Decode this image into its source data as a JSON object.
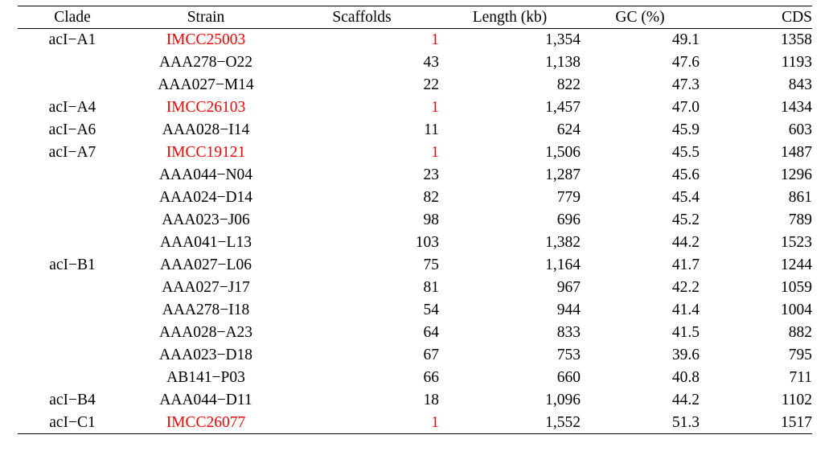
{
  "table": {
    "columns": [
      {
        "key": "clade",
        "label": "Clade",
        "align": "center"
      },
      {
        "key": "strain",
        "label": "Strain",
        "align": "center"
      },
      {
        "key": "scaffolds",
        "label": "Scaffolds",
        "align": "right"
      },
      {
        "key": "length",
        "label": "Length (kb)",
        "align": "right"
      },
      {
        "key": "gc",
        "label": "GC (%)",
        "align": "right"
      },
      {
        "key": "cds",
        "label": "CDS",
        "align": "right"
      }
    ],
    "highlight_color": "#ff0000",
    "text_color": "#000000",
    "rule_color": "#000000",
    "rows": [
      {
        "clade": "acI−A1",
        "strain": "IMCC25003",
        "scaffolds": "1",
        "length": "1,354",
        "gc": "49.1",
        "cds": "1358",
        "highlight": true
      },
      {
        "clade": "",
        "strain": "AAA278−O22",
        "scaffolds": "43",
        "length": "1,138",
        "gc": "47.6",
        "cds": "1193",
        "highlight": false
      },
      {
        "clade": "",
        "strain": "AAA027−M14",
        "scaffolds": "22",
        "length": "822",
        "gc": "47.3",
        "cds": "843",
        "highlight": false
      },
      {
        "clade": "acI−A4",
        "strain": "IMCC26103",
        "scaffolds": "1",
        "length": "1,457",
        "gc": "47.0",
        "cds": "1434",
        "highlight": true
      },
      {
        "clade": "acI−A6",
        "strain": "AAA028−I14",
        "scaffolds": "11",
        "length": "624",
        "gc": "45.9",
        "cds": "603",
        "highlight": false
      },
      {
        "clade": "acI−A7",
        "strain": "IMCC19121",
        "scaffolds": "1",
        "length": "1,506",
        "gc": "45.5",
        "cds": "1487",
        "highlight": true
      },
      {
        "clade": "",
        "strain": "AAA044−N04",
        "scaffolds": "23",
        "length": "1,287",
        "gc": "45.6",
        "cds": "1296",
        "highlight": false
      },
      {
        "clade": "",
        "strain": "AAA024−D14",
        "scaffolds": "82",
        "length": "779",
        "gc": "45.4",
        "cds": "861",
        "highlight": false
      },
      {
        "clade": "",
        "strain": "AAA023−J06",
        "scaffolds": "98",
        "length": "696",
        "gc": "45.2",
        "cds": "789",
        "highlight": false
      },
      {
        "clade": "",
        "strain": "AAA041−L13",
        "scaffolds": "103",
        "length": "1,382",
        "gc": "44.2",
        "cds": "1523",
        "highlight": false
      },
      {
        "clade": "acI−B1",
        "strain": "AAA027−L06",
        "scaffolds": "75",
        "length": "1,164",
        "gc": "41.7",
        "cds": "1244",
        "highlight": false
      },
      {
        "clade": "",
        "strain": "AAA027−J17",
        "scaffolds": "81",
        "length": "967",
        "gc": "42.2",
        "cds": "1059",
        "highlight": false
      },
      {
        "clade": "",
        "strain": "AAA278−I18",
        "scaffolds": "54",
        "length": "944",
        "gc": "41.4",
        "cds": "1004",
        "highlight": false
      },
      {
        "clade": "",
        "strain": "AAA028−A23",
        "scaffolds": "64",
        "length": "833",
        "gc": "41.5",
        "cds": "882",
        "highlight": false
      },
      {
        "clade": "",
        "strain": "AAA023−D18",
        "scaffolds": "67",
        "length": "753",
        "gc": "39.6",
        "cds": "795",
        "highlight": false
      },
      {
        "clade": "",
        "strain": "AB141−P03",
        "scaffolds": "66",
        "length": "660",
        "gc": "40.8",
        "cds": "711",
        "highlight": false
      },
      {
        "clade": "acI−B4",
        "strain": "AAA044−D11",
        "scaffolds": "18",
        "length": "1,096",
        "gc": "44.2",
        "cds": "1102",
        "highlight": false
      },
      {
        "clade": "acI−C1",
        "strain": "IMCC26077",
        "scaffolds": "1",
        "length": "1,552",
        "gc": "51.3",
        "cds": "1517",
        "highlight": true
      }
    ]
  }
}
